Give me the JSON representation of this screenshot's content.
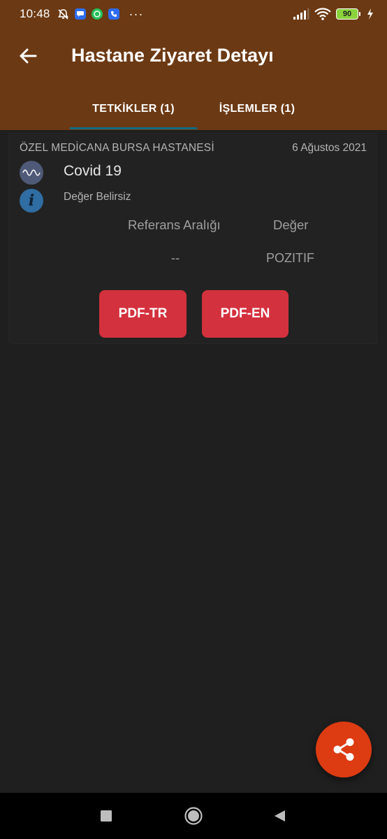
{
  "status_bar": {
    "time": "10:48",
    "more": "···",
    "battery": "90",
    "icons": [
      "mute-alarm-icon",
      "messages-app-icon",
      "whatsapp-icon",
      "phone-app-icon",
      "signal-icon",
      "wifi-icon",
      "battery-icon",
      "charging-icon"
    ]
  },
  "header": {
    "title": "Hastane Ziyaret Detayı",
    "back_icon": "arrow-left-icon"
  },
  "tabs": [
    {
      "label": "TETKİKLER (1)",
      "selected": true
    },
    {
      "label": "İŞLEMLER (1)",
      "selected": false
    }
  ],
  "card": {
    "hospital": "ÖZEL MEDİCANA BURSA HASTANESİ",
    "date": "6 Ağustos 2021",
    "test_name": "Covid 19",
    "value_status": "Değer Belirsiz",
    "columns": {
      "reference_header": "Referans Aralığı",
      "value_header": "Değer",
      "reference_value": "--",
      "value": "POZITIF"
    },
    "buttons": {
      "pdf_tr": "PDF-TR",
      "pdf_en": "PDF-EN"
    }
  },
  "fab": {
    "icon": "share-icon"
  },
  "nav": {
    "icons": [
      "recent-apps-icon",
      "home-icon",
      "back-triangle-icon"
    ]
  },
  "colors": {
    "header_bg": "#6b3913",
    "tab_indicator": "#0f6e86",
    "button_red": "#d3313d",
    "fab_orange": "#dd3b12",
    "background": "#1f1f1f"
  }
}
